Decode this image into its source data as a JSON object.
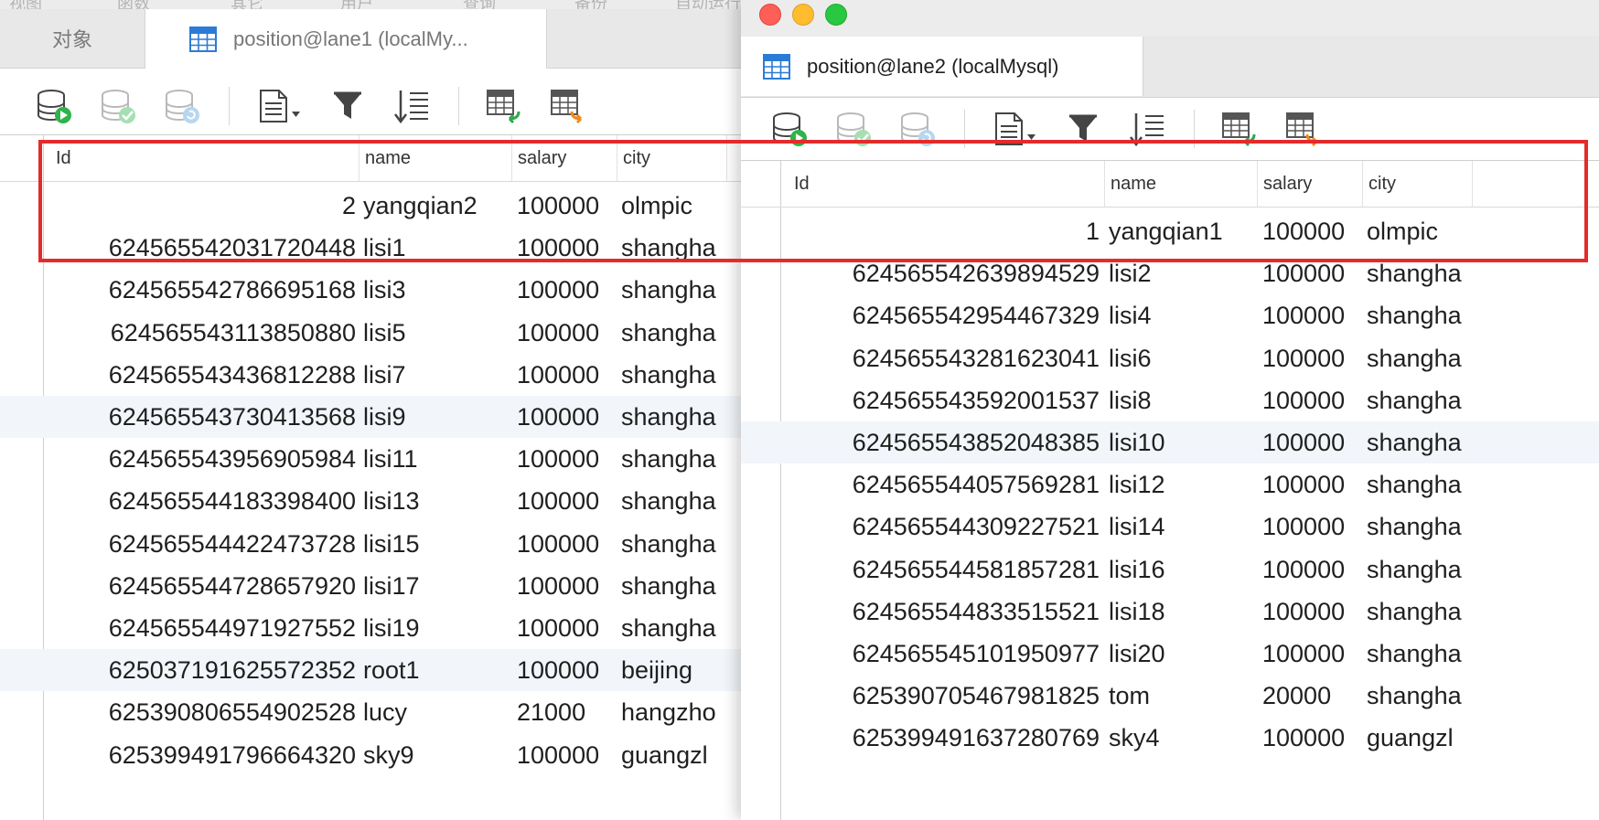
{
  "left_window": {
    "menubar": [
      "视图",
      "函数",
      "其它",
      "用户",
      "查询",
      "备份",
      "自动运行"
    ],
    "tabs": {
      "objects": "对象",
      "active": "position@lane1 (localMy..."
    },
    "columns": [
      "Id",
      "name",
      "salary",
      "city"
    ],
    "rows": [
      {
        "id": "2",
        "name": "yangqian2",
        "salary": "100000",
        "city": "olmpic"
      },
      {
        "id": "624565542031720448",
        "name": "lisi1",
        "salary": "100000",
        "city": "shangha"
      },
      {
        "id": "624565542786695168",
        "name": "lisi3",
        "salary": "100000",
        "city": "shangha"
      },
      {
        "id": "624565543113850880",
        "name": "lisi5",
        "salary": "100000",
        "city": "shangha"
      },
      {
        "id": "624565543436812288",
        "name": "lisi7",
        "salary": "100000",
        "city": "shangha"
      },
      {
        "id": "624565543730413568",
        "name": "lisi9",
        "salary": "100000",
        "city": "shangha"
      },
      {
        "id": "624565543956905984",
        "name": "lisi11",
        "salary": "100000",
        "city": "shangha"
      },
      {
        "id": "624565544183398400",
        "name": "lisi13",
        "salary": "100000",
        "city": "shangha"
      },
      {
        "id": "624565544422473728",
        "name": "lisi15",
        "salary": "100000",
        "city": "shangha"
      },
      {
        "id": "624565544728657920",
        "name": "lisi17",
        "salary": "100000",
        "city": "shangha"
      },
      {
        "id": "624565544971927552",
        "name": "lisi19",
        "salary": "100000",
        "city": "shangha"
      },
      {
        "id": "625037191625572352",
        "name": "root1",
        "salary": "100000",
        "city": "beijing"
      },
      {
        "id": "625390806554902528",
        "name": "lucy",
        "salary": "21000",
        "city": "hangzho"
      },
      {
        "id": "625399491796664320",
        "name": "sky9",
        "salary": "100000",
        "city": "guangzl"
      }
    ]
  },
  "right_window": {
    "tab": "position@lane2 (localMysql)",
    "columns": [
      "Id",
      "name",
      "salary",
      "city"
    ],
    "rows": [
      {
        "id": "1",
        "name": "yangqian1",
        "salary": "100000",
        "city": "olmpic"
      },
      {
        "id": "624565542639894529",
        "name": "lisi2",
        "salary": "100000",
        "city": "shangha"
      },
      {
        "id": "624565542954467329",
        "name": "lisi4",
        "salary": "100000",
        "city": "shangha"
      },
      {
        "id": "624565543281623041",
        "name": "lisi6",
        "salary": "100000",
        "city": "shangha"
      },
      {
        "id": "624565543592001537",
        "name": "lisi8",
        "salary": "100000",
        "city": "shangha"
      },
      {
        "id": "624565543852048385",
        "name": "lisi10",
        "salary": "100000",
        "city": "shangha"
      },
      {
        "id": "624565544057569281",
        "name": "lisi12",
        "salary": "100000",
        "city": "shangha"
      },
      {
        "id": "624565544309227521",
        "name": "lisi14",
        "salary": "100000",
        "city": "shangha"
      },
      {
        "id": "624565544581857281",
        "name": "lisi16",
        "salary": "100000",
        "city": "shangha"
      },
      {
        "id": "624565544833515521",
        "name": "lisi18",
        "salary": "100000",
        "city": "shangha"
      },
      {
        "id": "624565545101950977",
        "name": "lisi20",
        "salary": "100000",
        "city": "shangha"
      },
      {
        "id": "625390705467981825",
        "name": "tom",
        "salary": "20000",
        "city": "shangha"
      },
      {
        "id": "625399491637280769",
        "name": "sky4",
        "salary": "100000",
        "city": "guangzl"
      }
    ]
  },
  "toolbar_icons": [
    "database-run-icon",
    "database-commit-icon",
    "database-refresh-icon",
    "document-dropdown-icon",
    "filter-icon",
    "sort-icon",
    "import-table-icon",
    "export-table-icon"
  ],
  "colors": {
    "highlight": "#e32b2b",
    "traffic_close": "#ff5f57",
    "traffic_min": "#febc2e",
    "traffic_max": "#28c840",
    "table_icon": "#2b7bd6",
    "row_alt": "#f2f6fb"
  }
}
